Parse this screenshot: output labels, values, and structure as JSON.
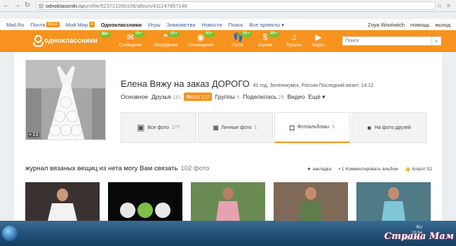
{
  "browser": {
    "url_host": "odnoklassniki.ru",
    "url_path": "/profile/523721050106/album/411147857146"
  },
  "topnav": {
    "items": [
      {
        "label": "Mail.Ru",
        "badge": ""
      },
      {
        "label": "Почта",
        "badge": "5531"
      },
      {
        "label": "Мой Мир",
        "badge": "4"
      },
      {
        "label": "Одноклассники",
        "badge": ""
      },
      {
        "label": "Игры",
        "badge": ""
      },
      {
        "label": "Знакомства",
        "badge": ""
      },
      {
        "label": "Новости",
        "badge": ""
      },
      {
        "label": "Поиск",
        "badge": ""
      },
      {
        "label": "Все проекты ▾",
        "badge": ""
      }
    ],
    "user": "Zoya Woolwitch",
    "help": "помощь",
    "logout": "выход"
  },
  "header": {
    "logo_text": "одноклассники",
    "logo_badge": "99+",
    "nav": [
      {
        "label": "Сообщения",
        "icon": "chat-icon",
        "badge": "99+"
      },
      {
        "label": "Обсуждения",
        "icon": "discussion-icon",
        "badge": "99+"
      },
      {
        "label": "Оповещения",
        "icon": "notification-icon",
        "badge": "99+"
      },
      {
        "label": "Гости",
        "icon": "footprints-icon",
        "badge": "99+"
      },
      {
        "label": "Оценки",
        "icon": "rating-icon",
        "badge": "99+"
      },
      {
        "label": "Музыка",
        "icon": "music-icon",
        "badge": ""
      },
      {
        "label": "Видео",
        "icon": "video-icon",
        "badge": ""
      }
    ],
    "search_placeholder": "Поиск",
    "accent_color": "#f7931e"
  },
  "profile": {
    "name": "Елена Вяжу на заказ ДОРОГО",
    "meta": "41 год, Зеленокумск, Россия Последний визит: 14:12",
    "photo_count": "13",
    "tabs": [
      {
        "label": "Основное",
        "count": ""
      },
      {
        "label": "Друзья",
        "count": "110"
      },
      {
        "label": "Фото",
        "count": "177",
        "active": true
      },
      {
        "label": "Группы",
        "count": "9"
      },
      {
        "label": "Поделилась",
        "count": "29"
      },
      {
        "label": "Видео",
        "count": ""
      },
      {
        "label": "Ещё ▾",
        "count": ""
      }
    ]
  },
  "album_tabs": [
    {
      "label": "Все фото",
      "count": "177",
      "icon": "photos-icon"
    },
    {
      "label": "Личные фото",
      "count": "1",
      "icon": "camera-icon"
    },
    {
      "label": "Фотоальбомы",
      "count": "5",
      "icon": "album-icon",
      "active": true
    },
    {
      "label": "На фото друзей",
      "count": "",
      "icon": "pin-icon"
    }
  ],
  "album": {
    "title": "журнал вязаных вещиц из нета могу Вам связать",
    "count": "102 фото",
    "bookmark": "закладка",
    "comments": "1 Комментировать альбом",
    "likes": "Класс! 52"
  },
  "taskbar": {
    "lang": "RU",
    "time": "15:54",
    "date": "18.09.2013"
  },
  "watermark": "Страна Мам"
}
